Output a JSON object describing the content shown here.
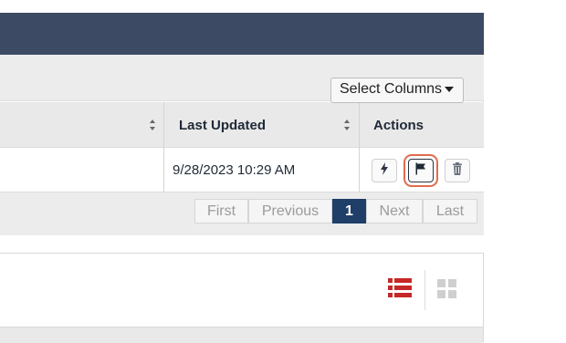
{
  "table": {
    "headers": {
      "last_updated": "Last Updated",
      "actions": "Actions"
    },
    "row": {
      "last_updated": "9/28/2023 10:29 AM"
    }
  },
  "actions": {
    "trigger_icon": "lightning-icon",
    "flag_icon": "flag-icon",
    "delete_icon": "trash-icon"
  },
  "pagination": {
    "first": "First",
    "previous": "Previous",
    "current_page": "1",
    "next": "Next",
    "last": "Last"
  },
  "view_toggle": {
    "list_icon": "list-view-icon",
    "grid_icon": "grid-view-icon"
  },
  "select_columns": {
    "label": "Select Columns"
  },
  "colors": {
    "header_bar": "#3d4a63",
    "active_page": "#1f3e68",
    "highlight_ring": "#e06b4f",
    "list_icon": "#c62828"
  }
}
